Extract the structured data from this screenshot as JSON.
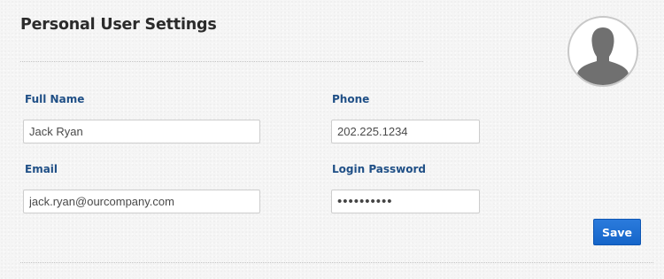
{
  "page": {
    "title": "Personal User Settings"
  },
  "avatar": {
    "icon": "user-silhouette-icon"
  },
  "form": {
    "full_name": {
      "label": "Full Name",
      "value": "Jack Ryan"
    },
    "phone": {
      "label": "Phone",
      "value": "202.225.1234"
    },
    "email": {
      "label": "Email",
      "value": "jack.ryan@ourcompany.com"
    },
    "login_password": {
      "label": "Login Password",
      "value": "••••••••••"
    }
  },
  "actions": {
    "save_label": "Save"
  },
  "colors": {
    "label": "#1f4f86",
    "title": "#2b2b2b",
    "button": "#1565c9",
    "background": "#f5f5f5"
  }
}
